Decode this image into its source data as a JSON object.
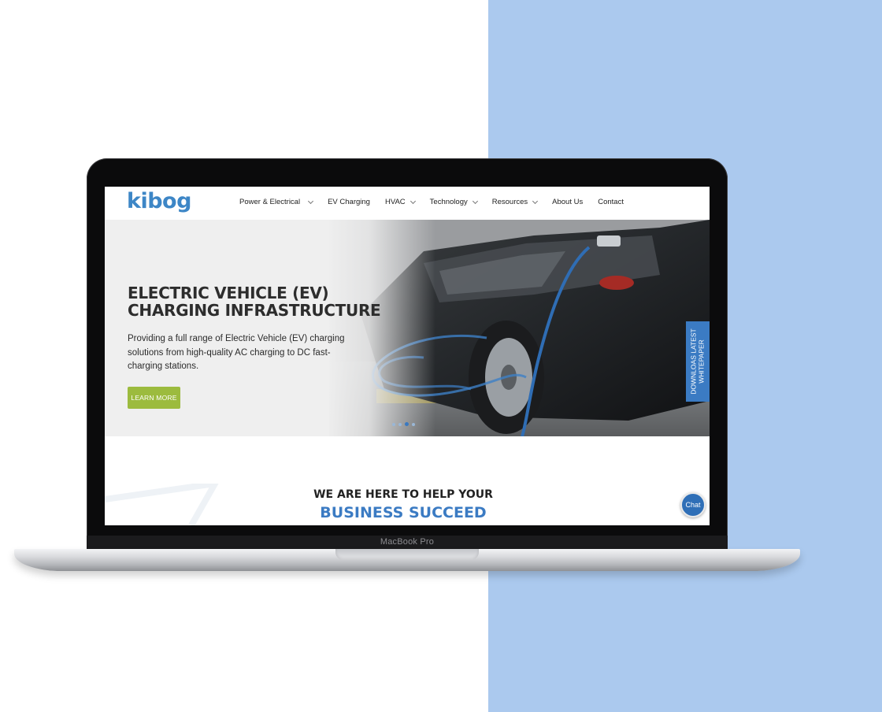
{
  "brand": {
    "logo_text": "kibog",
    "logo_color": "#3d86c6",
    "device_label": "MacBook Pro"
  },
  "nav": {
    "items": [
      {
        "label": "Power & Electrical",
        "has_dropdown": true
      },
      {
        "label": "EV Charging",
        "has_dropdown": false
      },
      {
        "label": "HVAC",
        "has_dropdown": true
      },
      {
        "label": "Technology",
        "has_dropdown": true
      },
      {
        "label": "Resources",
        "has_dropdown": true
      },
      {
        "label": "About Us",
        "has_dropdown": false
      },
      {
        "label": "Contact",
        "has_dropdown": false
      }
    ]
  },
  "hero": {
    "title_line1": "ELECTRIC VEHICLE (EV)",
    "title_line2": "CHARGING INFRASTRUCTURE",
    "description": "Providing a full range of Electric Vehicle (EV) charging solutions from high-quality AC charging to DC fast-charging stations.",
    "cta_label": "LEARN MORE",
    "cta_color": "#9cbb3e",
    "slides_total": 4,
    "slide_active": 3
  },
  "whitepaper_tab": {
    "line1": "DOWNLOAS LATEST",
    "line2": "WHITEPAPER",
    "color": "#3b7bc3"
  },
  "section_help": {
    "line1": "WE ARE HERE TO HELP YOUR",
    "line2": "BUSINESS SUCCEED",
    "accent_color": "#3b7bc3"
  },
  "chat": {
    "label": "Chat"
  },
  "colors": {
    "background_panel": "#abc9ee",
    "accent": "#3b7bc3"
  }
}
